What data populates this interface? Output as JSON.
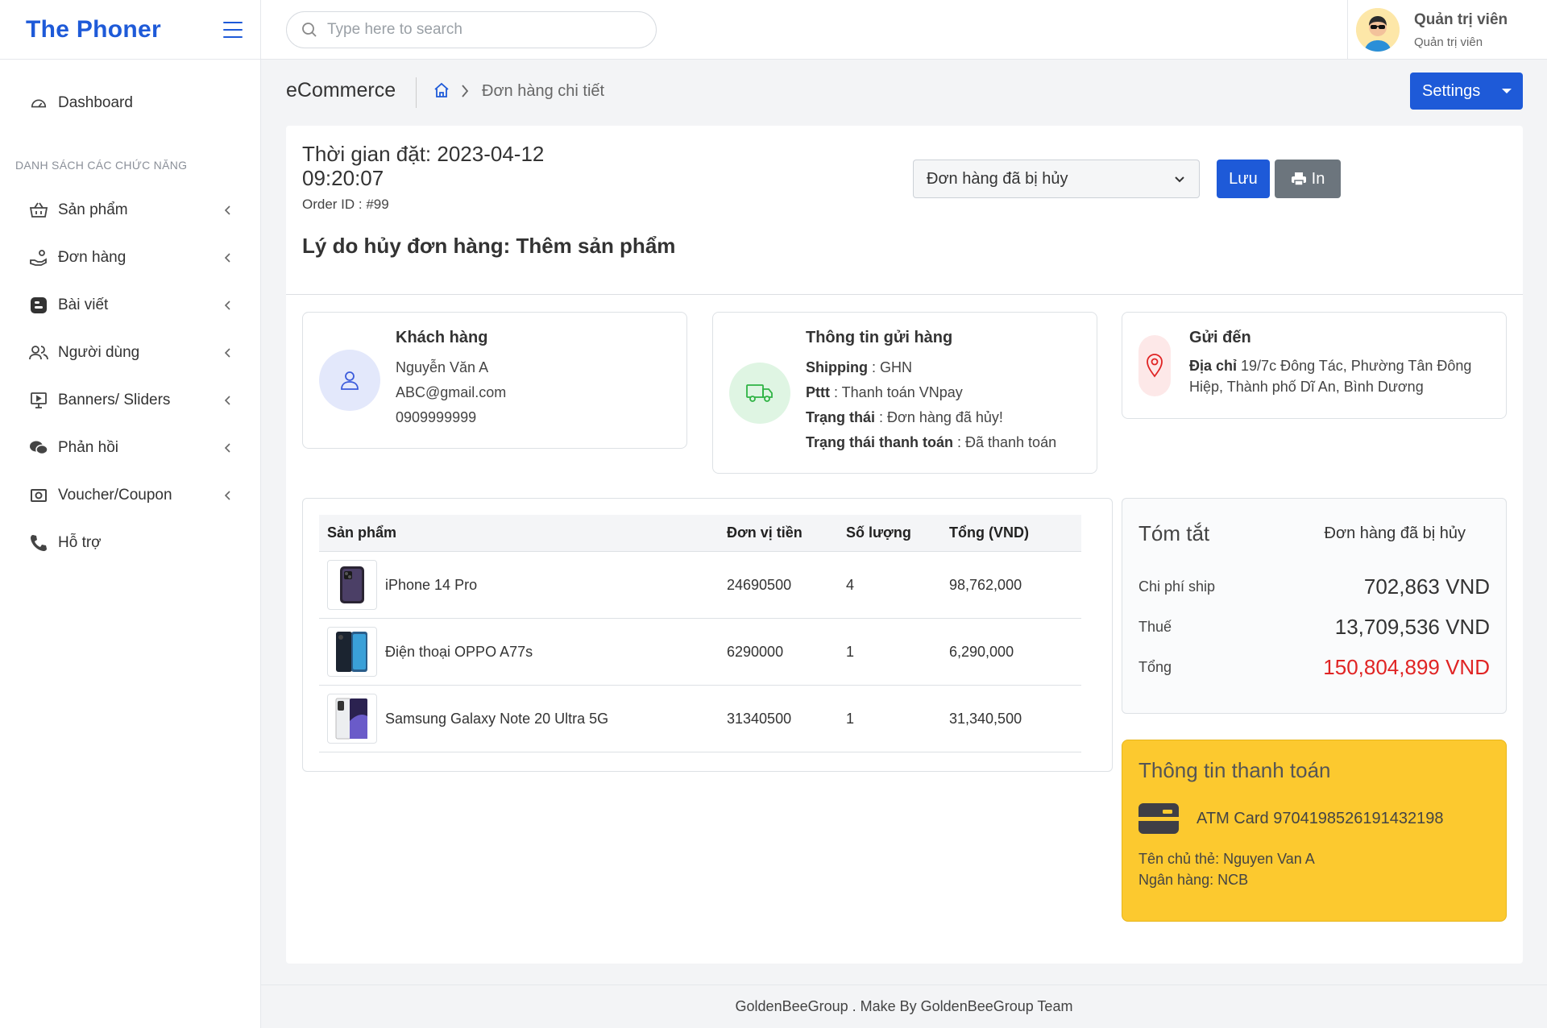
{
  "brand": {
    "name": "The Phoner"
  },
  "search": {
    "placeholder": "Type here to search"
  },
  "user": {
    "name": "Quản trị viên",
    "role": "Quản trị viên"
  },
  "sidebar": {
    "dashboard": "Dashboard",
    "section_title": "DANH SÁCH CÁC CHỨC NĂNG",
    "items": [
      {
        "label": "Sản phẩm",
        "icon": "basket-icon"
      },
      {
        "label": "Đơn hàng",
        "icon": "hand-coins-icon"
      },
      {
        "label": "Bài viết",
        "icon": "blogger-icon"
      },
      {
        "label": "Người dùng",
        "icon": "users-icon"
      },
      {
        "label": "Banners/ Sliders",
        "icon": "presentation-icon"
      },
      {
        "label": "Phản hồi",
        "icon": "chat-bubbles-icon"
      },
      {
        "label": "Voucher/Coupon",
        "icon": "coupon-icon"
      },
      {
        "label": "Hỗ trợ",
        "icon": "phone-icon"
      }
    ]
  },
  "breadcrumb": {
    "title": "eCommerce",
    "page": "Đơn hàng chi tiết"
  },
  "settings": {
    "label": "Settings"
  },
  "order": {
    "time": "Thời gian đặt: 2023-04-12 09:20:07",
    "id": "Order ID : #99",
    "cancel_reason": "Lý do hủy đơn hàng: Thêm sản phẩm",
    "status_selected": "Đơn hàng đã bị hủy",
    "save_label": "Lưu",
    "print_label": "In"
  },
  "customer": {
    "title": "Khách hàng",
    "name": "Nguyễn Văn A",
    "email": "ABC@gmail.com",
    "phone": "0909999999"
  },
  "shipping": {
    "title": "Thông tin gửi hàng",
    "shipping_label": "Shipping",
    "shipping_value": " : GHN",
    "pttt_label": "Pttt",
    "pttt_value": " : Thanh toán VNpay",
    "status_label": "Trạng thái",
    "status_value": " : Đơn hàng đã hủy!",
    "pay_status_label": "Trạng thái thanh toán",
    "pay_status_value": " : Đã thanh toán"
  },
  "destination": {
    "title": "Gửi đến",
    "address_label": "Địa chỉ",
    "address_value": " 19/7c Đông Tác, Phường Tân Đông Hiệp, Thành phố Dĩ An, Bình Dương"
  },
  "products": {
    "headers": [
      "Sản phẩm",
      "Đơn vị tiền",
      "Số lượng",
      "Tổng (VND)"
    ],
    "rows": [
      {
        "name": "iPhone 14 Pro",
        "price": "24690500",
        "qty": "4",
        "total": "98,762,000"
      },
      {
        "name": "Điện thoại OPPO A77s",
        "price": "6290000",
        "qty": "1",
        "total": "6,290,000"
      },
      {
        "name": "Samsung Galaxy Note 20 Ultra 5G",
        "price": "31340500",
        "qty": "1",
        "total": "31,340,500"
      }
    ]
  },
  "summary": {
    "title": "Tóm tắt",
    "status": "Đơn hàng đã bị hủy",
    "ship_label": "Chi phí ship",
    "ship_value": "702,863 VND",
    "tax_label": "Thuế",
    "tax_value": "13,709,536 VND",
    "total_label": "Tổng",
    "total_value": "150,804,899 VND"
  },
  "payment": {
    "title": "Thông tin thanh toán",
    "card": "ATM Card 9704198526191432198",
    "holder": "Tên chủ thẻ: Nguyen Van A",
    "bank": "Ngân hàng: NCB"
  },
  "footer": {
    "text": "GoldenBeeGroup . Make By GoldenBeeGroup Team"
  },
  "colors": {
    "primary": "#1e5ad8",
    "danger": "#e02424",
    "payment_bg": "#fcc92f",
    "secondary": "#6c757d"
  }
}
